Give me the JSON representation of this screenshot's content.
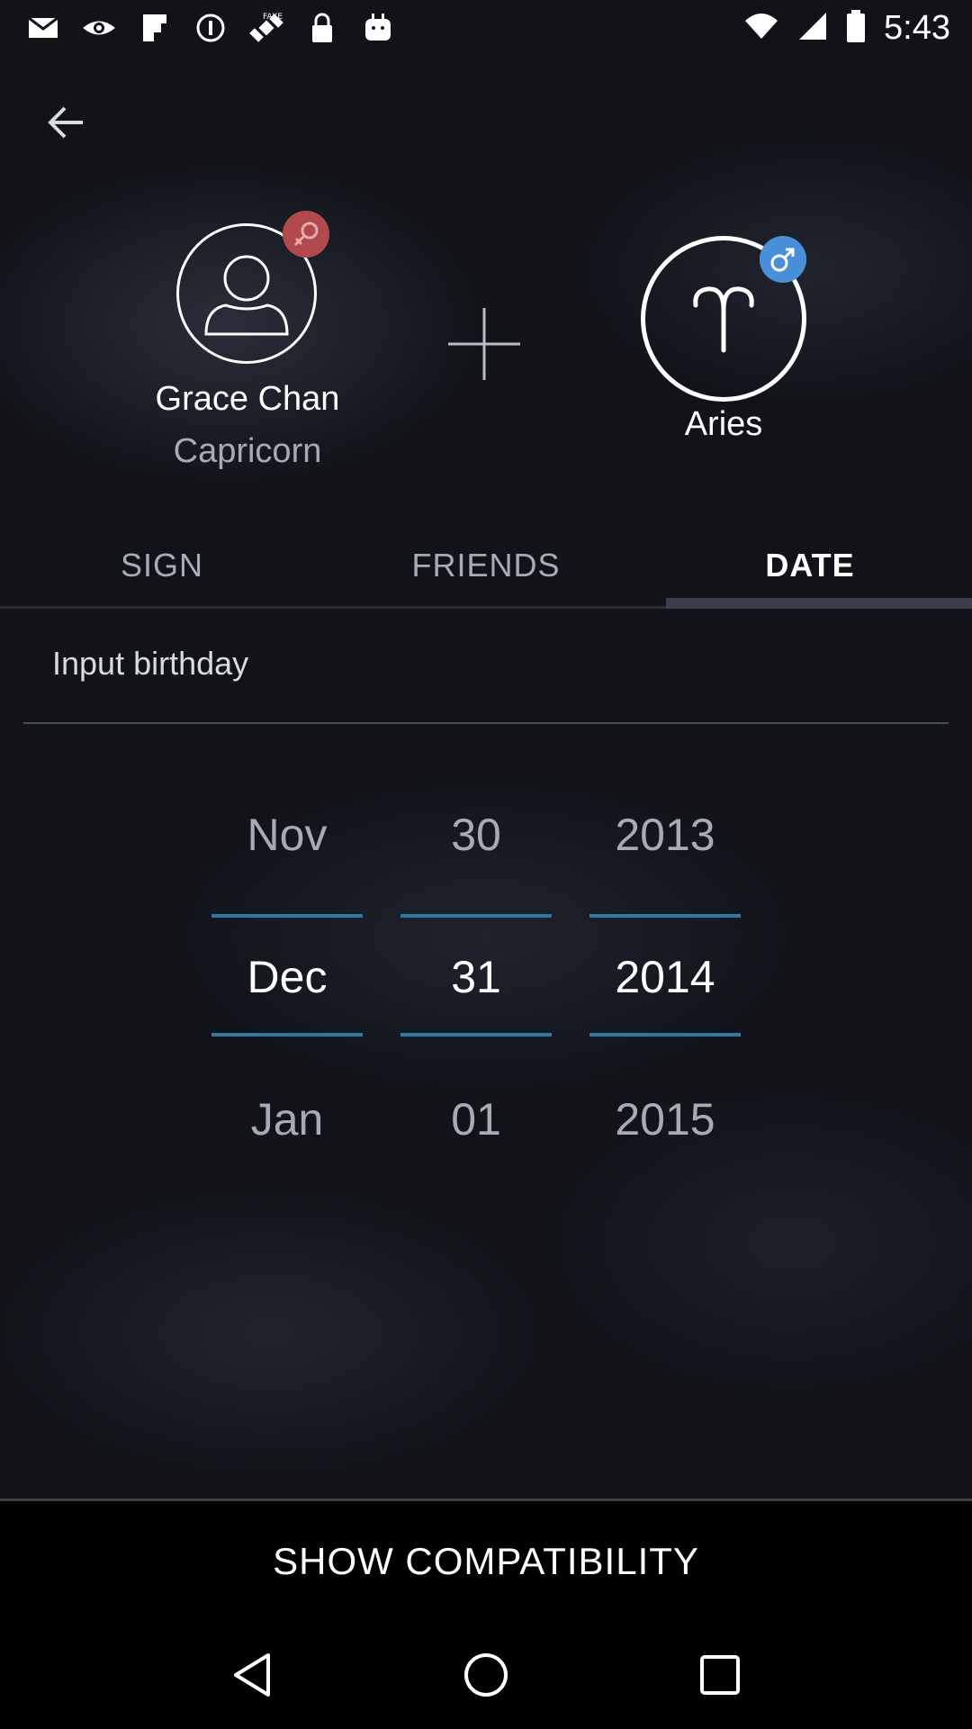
{
  "status_bar": {
    "time": "5:43",
    "icons": [
      "mail-icon",
      "eye-icon",
      "flipboard-icon",
      "info-icon",
      "satellite-fake-gps-icon",
      "lock-icon",
      "android-icon",
      "wifi-icon",
      "signal-icon",
      "battery-icon"
    ]
  },
  "header": {
    "back_icon": "arrow-back-icon"
  },
  "profile": {
    "name": "Grace Chan",
    "sign": "Capricorn",
    "gender_icon": "female-icon",
    "avatar_icon": "person-icon"
  },
  "add_icon": "plus-icon",
  "partner": {
    "sign": "Aries",
    "sign_icon": "aries-icon",
    "gender_icon": "male-icon"
  },
  "tabs": [
    {
      "label": "SIGN",
      "active": false
    },
    {
      "label": "FRIENDS",
      "active": false
    },
    {
      "label": "DATE",
      "active": true
    }
  ],
  "birthday": {
    "label": "Input birthday"
  },
  "picker": {
    "month": {
      "prev": "Nov",
      "current": "Dec",
      "next": "Jan"
    },
    "day": {
      "prev": "30",
      "current": "31",
      "next": "01"
    },
    "year": {
      "prev": "2013",
      "current": "2014",
      "next": "2015"
    }
  },
  "actions": {
    "show_compatibility": "SHOW COMPATIBILITY"
  },
  "nav": {
    "back": "nav-back-icon",
    "home": "nav-home-icon",
    "recents": "nav-recents-icon"
  },
  "colors": {
    "accent": "#2f78a5",
    "female_badge": "#b04a4e",
    "male_badge": "#4a90d9",
    "background": "#111319"
  }
}
